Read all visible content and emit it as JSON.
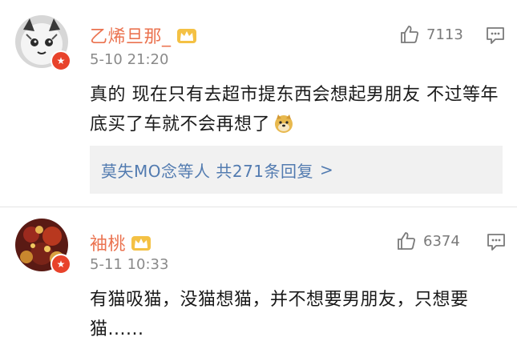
{
  "comments": [
    {
      "username": "乙烯旦那_",
      "timestamp": "5-10 21:20",
      "likes": "7113",
      "text": "真的 现在只有去超市提东西会想起男朋友 不过等年底买了车就不会再想了",
      "replies": {
        "authors": "莫失MO念等人",
        "summary": "共271条回复",
        "chevron": ">"
      },
      "colors": {
        "username": "#eb7350",
        "link": "#527bb0"
      }
    },
    {
      "username": "袖桃",
      "timestamp": "5-11 10:33",
      "likes": "6374",
      "text": "有猫吸猫，没猫想猫，并不想要男朋友，只想要猫......",
      "colors": {
        "username": "#eb7350"
      }
    }
  ],
  "icons": {
    "like": "thumbs-up-icon",
    "reply": "comment-icon",
    "vip": "vip-badge-icon",
    "crown": "crown-icon",
    "emoji": "doge-emoji-icon"
  }
}
